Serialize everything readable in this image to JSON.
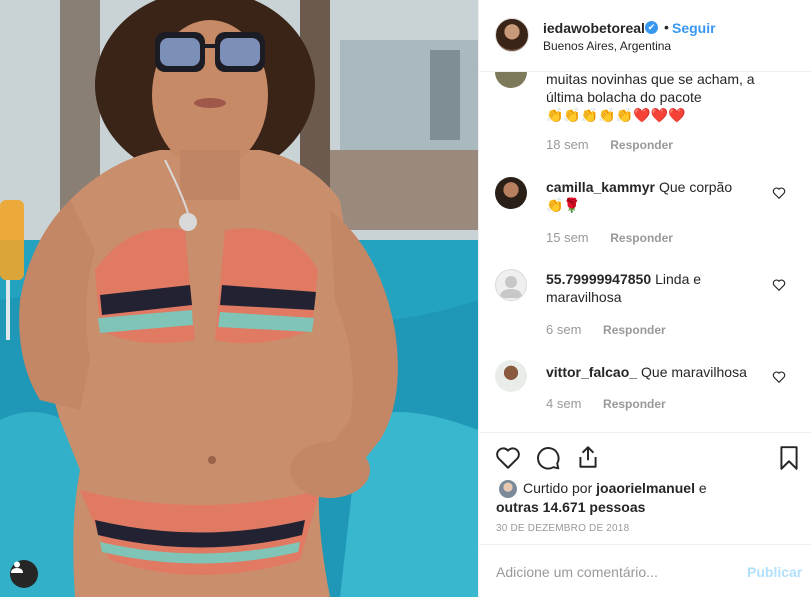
{
  "post": {
    "username": "iedawobetoreal",
    "verified": "✔",
    "separator": "•",
    "follow_label": "Seguir",
    "location": "Buenos Aires, Argentina"
  },
  "comments": [
    {
      "username": "",
      "text": "muitas novinhas que se acham, a última bolacha do pacote",
      "emojis": "👏👏👏👏👏❤️❤️❤️",
      "time": "18 sem",
      "reply_label": "Responder"
    },
    {
      "username": "camilla_kammyr",
      "text": "Que corpão",
      "emojis": "👏🌹",
      "time": "15 sem",
      "reply_label": "Responder"
    },
    {
      "username": "55.79999947850",
      "text": "Linda e maravilhosa",
      "emojis": "",
      "time": "6 sem",
      "reply_label": "Responder"
    },
    {
      "username": "vittor_falcao_",
      "text": "Que maravilhosa",
      "emojis": "",
      "time": "4 sem",
      "reply_label": "Responder"
    }
  ],
  "likes": {
    "prefix": "Curtido por",
    "user": "joaorielmanuel",
    "connector": "e",
    "others": "outras 14.671 pessoas"
  },
  "date": "30 DE DEZEMBRO DE 2018",
  "add_comment": {
    "placeholder": "Adicione um comentário...",
    "publish_label": "Publicar"
  },
  "icons": {
    "like": "heart-icon",
    "comment": "comment-icon",
    "share": "share-icon",
    "save": "bookmark-icon",
    "tag": "user-tag-icon"
  },
  "colors": {
    "link_blue": "#3897f0",
    "publish_disabled": "#b2dffc",
    "meta_gray": "#999999"
  }
}
